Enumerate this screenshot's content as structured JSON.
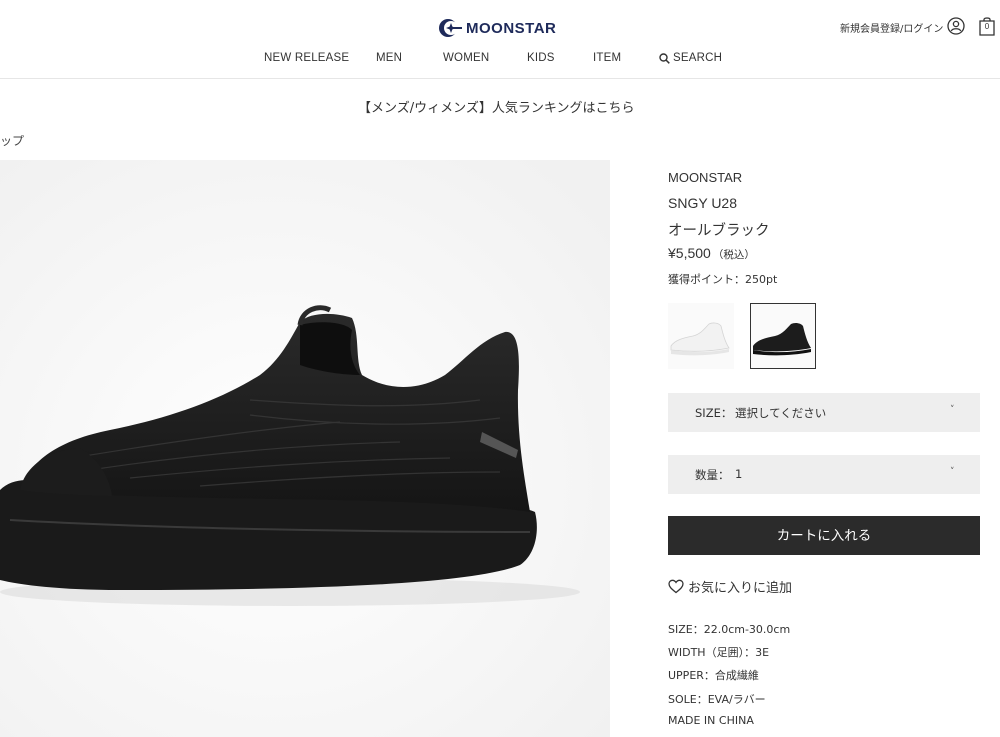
{
  "header": {
    "logo_text": "MOONSTAR",
    "account_link": "新規会員登録/ログイン",
    "cart_count": "0"
  },
  "nav": {
    "items": [
      "NEW RELEASE",
      "MEN",
      "WOMEN",
      "KIDS",
      "ITEM"
    ],
    "search_label": "SEARCH"
  },
  "banner": {
    "text": "【メンズ/ウィメンズ】人気ランキングはこちら"
  },
  "breadcrumb": {
    "text": "ップ"
  },
  "product": {
    "brand": "MOONSTAR",
    "model": "SNGY U28",
    "color": "オールブラック",
    "price": "¥5,500",
    "tax": "（税込）",
    "points": "獲得ポイント：250pt",
    "swatches": [
      {
        "name": "white",
        "selected": false
      },
      {
        "name": "black",
        "selected": true
      }
    ],
    "size_label": "SIZE：",
    "size_value": "選択してください",
    "qty_label": "数量：",
    "qty_value": "1",
    "cart_button": "カートに入れる",
    "favorite": "お気に入りに追加",
    "specs": [
      "SIZE：22.0cm-30.0cm",
      "WIDTH（足囲）：3E",
      "UPPER：合成繊維",
      "SOLE：EVA/ラバー",
      "MADE IN CHINA"
    ]
  },
  "colors": {
    "brand_navy": "#1e2a5a",
    "cart_button_bg": "#2b2b2b",
    "select_bg": "#eeeeee"
  }
}
